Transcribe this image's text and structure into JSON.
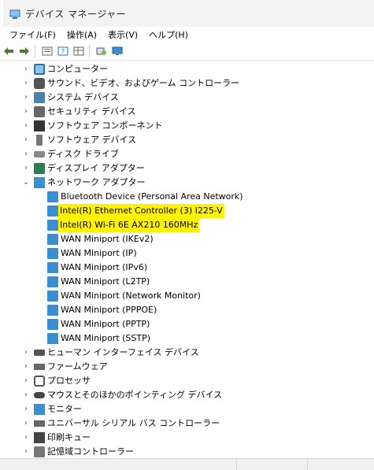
{
  "window": {
    "title": "デバイス マネージャー"
  },
  "menu": [
    "ファイル(F)",
    "操作(A)",
    "表示(V)",
    "ヘルプ(H)"
  ],
  "toolbar_icons": [
    "back-arrow-icon",
    "forward-arrow-icon",
    "properties-icon",
    "help-icon",
    "grid-view-icon",
    "scan-hardware-icon",
    "monitor-icon"
  ],
  "tree": {
    "categories_top": [
      {
        "label": "コンピューター",
        "icon": "computer-icon"
      },
      {
        "label": "サウンド、ビデオ、およびゲーム コントローラー",
        "icon": "speaker-icon"
      },
      {
        "label": "システム デバイス",
        "icon": "system-device-icon"
      },
      {
        "label": "セキュリティ デバイス",
        "icon": "security-device-icon"
      },
      {
        "label": "ソフトウェア コンポーネント",
        "icon": "software-component-icon"
      },
      {
        "label": "ソフトウェア デバイス",
        "icon": "software-device-icon"
      },
      {
        "label": "ディスク ドライブ",
        "icon": "disk-drive-icon"
      },
      {
        "label": "ディスプレイ アダプター",
        "icon": "display-adapter-icon"
      },
      {
        "label": "ネットワーク アダプター",
        "icon": "network-adapter-icon"
      }
    ],
    "network_children": [
      "Bluetooth Device (Personal Area Network)",
      "Intel(R) Ethernet Controller (3) I225-V",
      "Intel(R) Wi-Fi 6E AX210 160MHz",
      "WAN Miniport (IKEv2)",
      "WAN Miniport (IP)",
      "WAN Miniport (IPv6)",
      "WAN Miniport (L2TP)",
      "WAN Miniport (Network Monitor)",
      "WAN Miniport (PPPOE)",
      "WAN Miniport (PPTP)",
      "WAN Miniport (SSTP)"
    ],
    "categories_bottom": [
      {
        "label": "ヒューマン インターフェイス デバイス",
        "icon": "hid-icon"
      },
      {
        "label": "ファームウェア",
        "icon": "firmware-icon"
      },
      {
        "label": "プロセッサ",
        "icon": "processor-icon"
      },
      {
        "label": "マウスとそのほかのポインティング デバイス",
        "icon": "mouse-icon"
      },
      {
        "label": "モニター",
        "icon": "monitor-icon"
      },
      {
        "label": "ユニバーサル シリアル バス コントローラー",
        "icon": "usb-controller-icon"
      },
      {
        "label": "印刷キュー",
        "icon": "print-queue-icon"
      },
      {
        "label": "記憶域コントローラー",
        "icon": "storage-controller-icon"
      }
    ]
  },
  "colors": {
    "highlight": "#fff200",
    "accent": "#3a8fd0"
  }
}
